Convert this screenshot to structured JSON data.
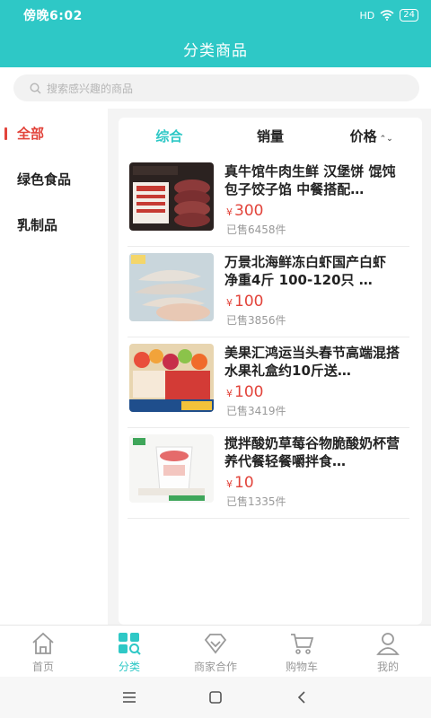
{
  "status_bar": {
    "time": "傍晚6:02",
    "signal": "HD",
    "battery": "24"
  },
  "header": {
    "title": "分类商品"
  },
  "search": {
    "placeholder": "搜索感兴趣的商品"
  },
  "categories": [
    {
      "label": "全部",
      "active": true
    },
    {
      "label": "绿色食品",
      "active": false
    },
    {
      "label": "乳制品",
      "active": false
    }
  ],
  "sort": [
    {
      "label": "综合",
      "active": true
    },
    {
      "label": "销量",
      "active": false
    },
    {
      "label": "价格",
      "active": false
    }
  ],
  "currency": "¥",
  "products": [
    {
      "name": "真牛馆牛肉生鲜 汉堡饼 馄饨包子饺子馅 中餐搭配…",
      "price": "300",
      "sold": "已售6458件"
    },
    {
      "name": "万景北海鲜冻白虾国产白虾 净重4斤 100-120只 …",
      "price": "100",
      "sold": "已售3856件"
    },
    {
      "name": "美果汇鸿运当头春节高端混搭水果礼盒约10斤送…",
      "price": "100",
      "sold": "已售3419件"
    },
    {
      "name": "搅拌酸奶草莓谷物脆酸奶杯营养代餐轻餐嚼拌食…",
      "price": "10",
      "sold": "已售1335件"
    }
  ],
  "tabs": [
    {
      "label": "首页",
      "icon": "home-icon",
      "active": false
    },
    {
      "label": "分类",
      "icon": "category-icon",
      "active": true
    },
    {
      "label": "商家合作",
      "icon": "diamond-icon",
      "active": false
    },
    {
      "label": "购物车",
      "icon": "cart-icon",
      "active": false
    },
    {
      "label": "我的",
      "icon": "user-icon",
      "active": false
    }
  ],
  "colors": {
    "accent": "#2ec8c6",
    "price": "#e2443b"
  }
}
